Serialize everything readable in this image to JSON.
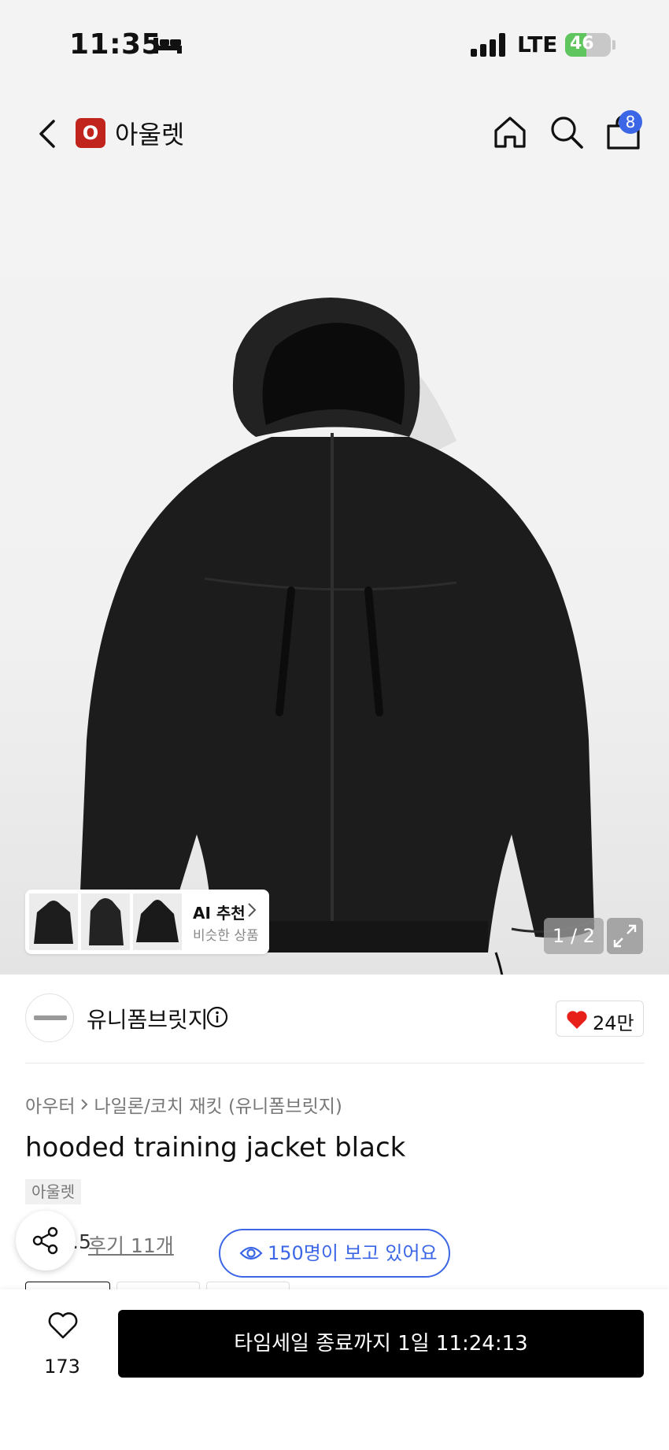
{
  "status_bar": {
    "time": "11:35",
    "network": "LTE",
    "battery_level": "46",
    "battery_fraction": 0.46
  },
  "nav": {
    "brand_badge": "O",
    "brand_name": "아울렛",
    "cart_count": "8",
    "colors": {
      "brand_badge": "#c0241c",
      "cart_badge": "#3b66e6"
    }
  },
  "gallery": {
    "ai_title": "AI 추천",
    "ai_subtitle": "비슷한 상품",
    "counter": "1 / 2"
  },
  "brand": {
    "shop_name": "유니폼브릿지",
    "like_count": "24만"
  },
  "product": {
    "breadcrumb": [
      "아우터",
      "나일론/코치 재킷 (유니폼브릿지)"
    ],
    "title": "hooded training jacket black",
    "tag": "아울렛",
    "rating_fragment": ".5",
    "reviews_label": "후기 11개",
    "viewers_label": "150명이 보고 있어요",
    "accent_color": "#3b66e6"
  },
  "bottom_bar": {
    "wish_count": "173",
    "cta_label": "타임세일 종료까지 1일 11:24:13"
  }
}
